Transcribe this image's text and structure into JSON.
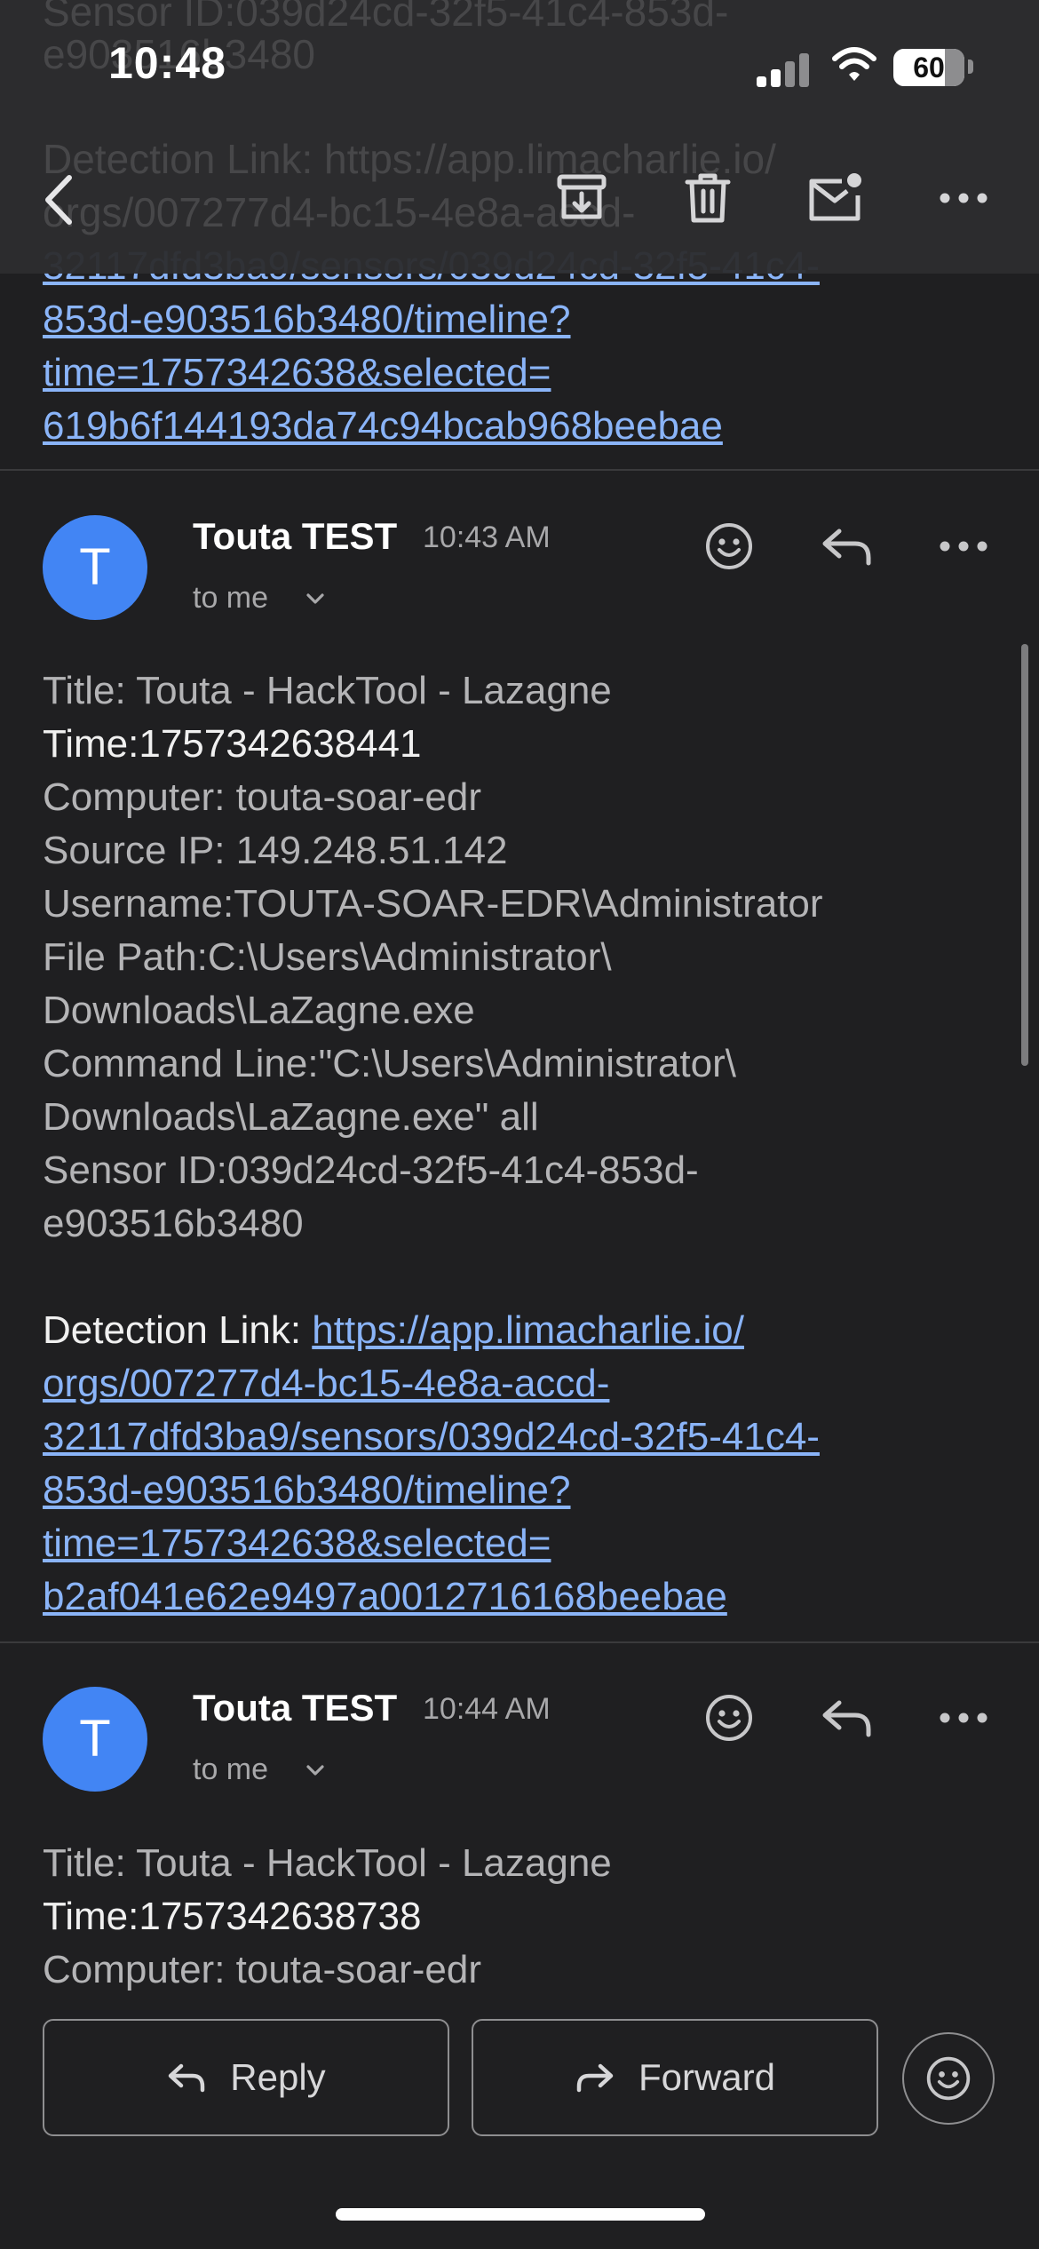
{
  "status_bar": {
    "time": "10:48",
    "battery": "60"
  },
  "behind_bar_text": {
    "line1": "Sensor ID:039d24cd-32f5-41c4-853d-",
    "line2": "e903516b3480",
    "line3": "Detection Link: https://app.limacharlie.io/",
    "line4": "orgs/007277d4-bc15-4e8a-accd-"
  },
  "prev_message_tail": {
    "link_lines": [
      "32117dfd3ba9/sensors/039d24cd-32f5-41c4-",
      "853d-e903516b3480/timeline?",
      "time=1757342638&selected=",
      "619b6f144193da74c94bcab968beebae"
    ]
  },
  "message1": {
    "avatar_initial": "T",
    "sender": "Touta TEST",
    "time": "10:43 AM",
    "recipient": "to me",
    "lines": {
      "title": "Title: Touta - HackTool - Lazagne",
      "time": "Time:1757342638441",
      "computer": "Computer: touta-soar-edr",
      "source_ip": "Source IP: 149.248.51.142",
      "username": "Username:TOUTA-SOAR-EDR\\Administrator",
      "file_path_1": "File Path:C:\\Users\\Administrator\\",
      "file_path_2": "Downloads\\LaZagne.exe",
      "command_line_1": "Command Line:\"C:\\Users\\Administrator\\",
      "command_line_2": "Downloads\\LaZagne.exe\" all",
      "sensor_1": "Sensor ID:039d24cd-32f5-41c4-853d-",
      "sensor_2": "e903516b3480"
    },
    "detection_label": "Detection Link: ",
    "detection_link_lines": [
      "https://app.limacharlie.io/",
      "orgs/007277d4-bc15-4e8a-accd-",
      "32117dfd3ba9/sensors/039d24cd-32f5-41c4-",
      "853d-e903516b3480/timeline?",
      "time=1757342638&selected=",
      "b2af041e62e9497a0012716168beebae"
    ]
  },
  "message2": {
    "avatar_initial": "T",
    "sender": "Touta TEST",
    "time": "10:44 AM",
    "recipient": "to me",
    "lines": {
      "title": "Title: Touta - HackTool - Lazagne",
      "time": "Time:1757342638738",
      "computer": "Computer: touta-soar-edr"
    }
  },
  "bottom_actions": {
    "reply_label": "Reply",
    "forward_label": "Forward"
  },
  "icons": {
    "back": "chevron-left-icon",
    "archive": "archive-icon",
    "delete": "trash-icon",
    "unread": "mail-unread-icon",
    "more": "more-horizontal-icon",
    "emoji": "smiley-icon",
    "reply": "reply-icon",
    "forward": "forward-icon"
  },
  "colors": {
    "background": "#1f1f21",
    "link": "#8ab4f8",
    "avatar": "#4285f4"
  }
}
